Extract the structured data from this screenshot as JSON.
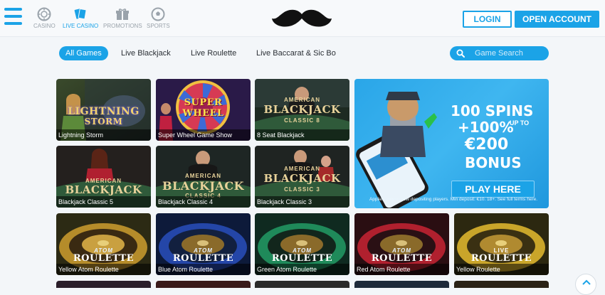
{
  "header": {
    "nav": [
      {
        "label": "CASINO",
        "icon": "chip-icon"
      },
      {
        "label": "LIVE CASINO",
        "icon": "cards-icon",
        "active": true
      },
      {
        "label": "PROMOTIONS",
        "icon": "gift-icon"
      },
      {
        "label": "SPORTS",
        "icon": "soccer-ball-icon"
      }
    ],
    "login_label": "LOGIN",
    "open_account_label": "OPEN ACCOUNT",
    "logo_icon": "mustache-logo"
  },
  "tabs": [
    {
      "label": "All Games",
      "active": true
    },
    {
      "label": "Live Blackjack"
    },
    {
      "label": "Live Roulette"
    },
    {
      "label": "Live Baccarat & Sic Bo"
    }
  ],
  "search": {
    "placeholder": "Game Search"
  },
  "games": [
    {
      "caption": "Lightning Storm",
      "logo": "LIGHTNING",
      "logo2": "STORM"
    },
    {
      "caption": "Super Wheel Game Show",
      "logo": "SUPER",
      "logo2": "WHEEL"
    },
    {
      "caption": "8 Seat Blackjack",
      "logo": "BLACKJACK",
      "logo_top": "AMERICAN",
      "logo_sub": "CLASSIC 8"
    },
    {
      "caption": "Blackjack Classic 5",
      "logo": "BLACKJACK",
      "logo_top": "AMERICAN",
      "logo_sub": ""
    },
    {
      "caption": "Blackjack Classic 4",
      "logo": "BLACKJACK",
      "logo_top": "AMERICAN",
      "logo_sub": "CLASSIC 4"
    },
    {
      "caption": "Blackjack Classic 3",
      "logo": "BLACKJACK",
      "logo_top": "AMERICAN",
      "logo_sub": "CLASSIC 3"
    },
    {
      "caption": "Yellow Atom Roulette",
      "logo": "ROULETTE",
      "logo_top": "ATOM"
    },
    {
      "caption": "Blue Atom Roulette",
      "logo": "ROULETTE",
      "logo_top": "ATOM"
    },
    {
      "caption": "Green Atom Roulette",
      "logo": "ROULETTE",
      "logo_top": "ATOM"
    },
    {
      "caption": "Red Atom Roulette",
      "logo": "ROULETTE",
      "logo_top": "ATOM"
    },
    {
      "caption": "Yellow Roulette",
      "logo": "ROULETTE",
      "logo_top": "LIVE"
    }
  ],
  "promo": {
    "line1": "100 SPINS",
    "line2": "+100%",
    "line2_upto": "UP TO",
    "line3": "€200",
    "line4": "BONUS",
    "cta": "PLAY HERE",
    "fine_print": "Applies only to new depositing players. Min deposit: €10. 18+. See full terms here."
  },
  "colors": {
    "accent": "#1ba3e7",
    "muted": "#9aa3ab"
  }
}
